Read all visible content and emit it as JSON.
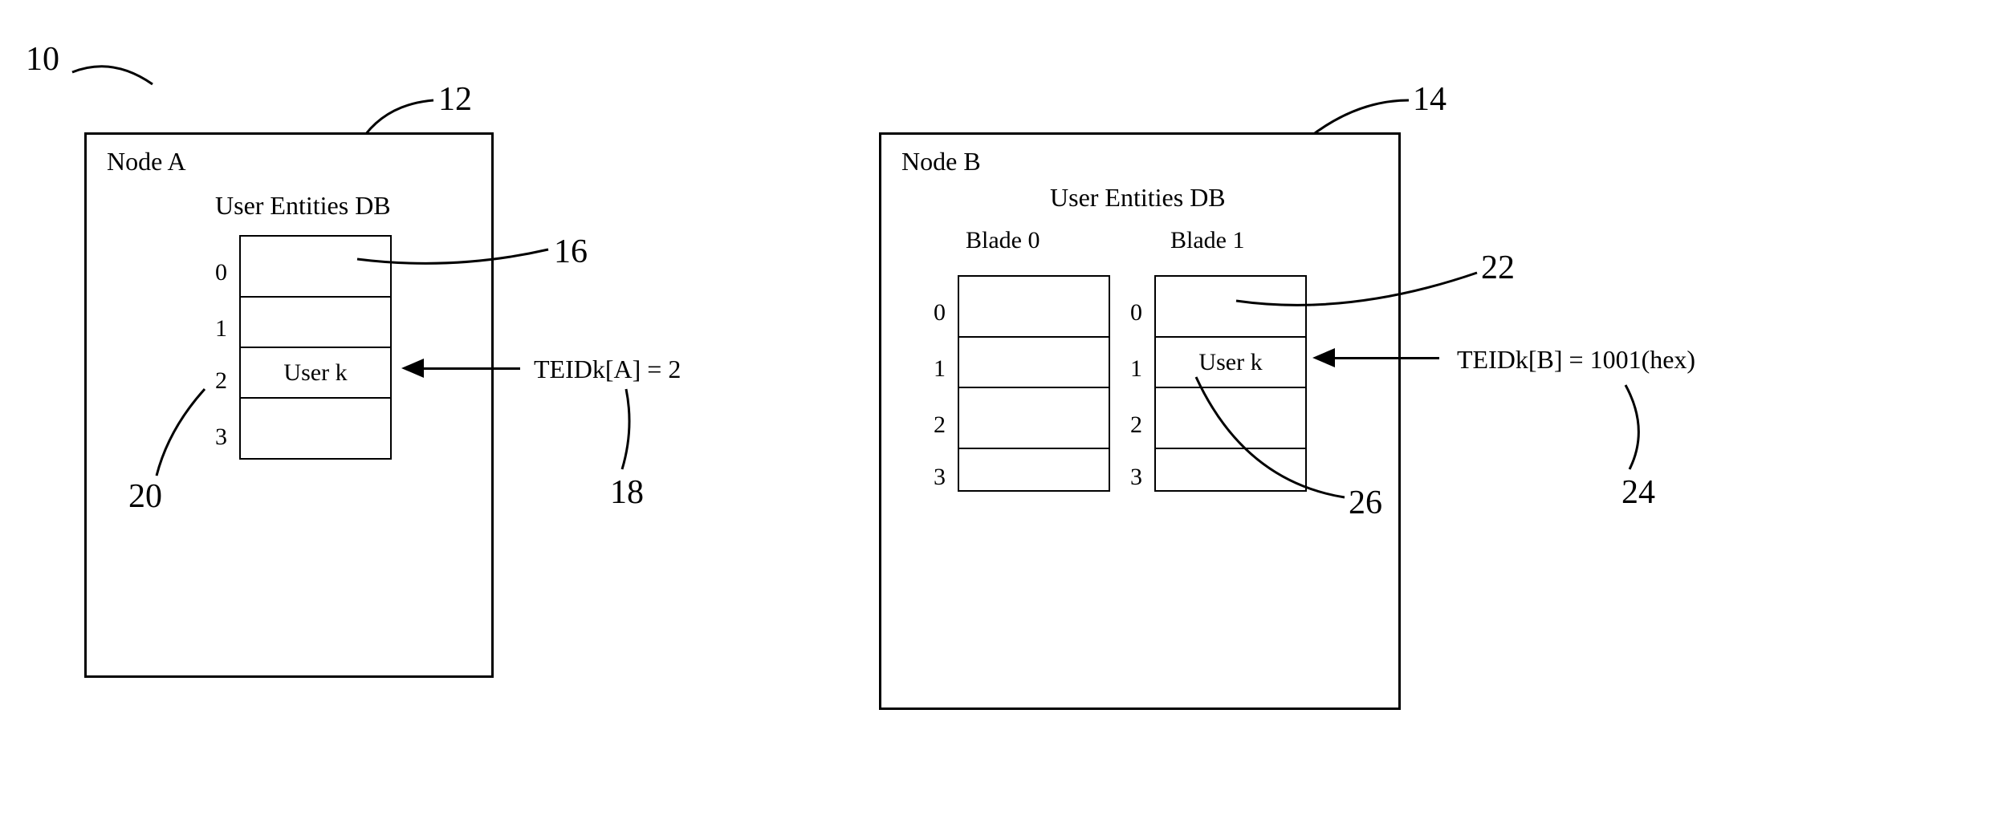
{
  "ref": {
    "r10": "10",
    "r12": "12",
    "r14": "14",
    "r16": "16",
    "r18": "18",
    "r20": "20",
    "r22": "22",
    "r24": "24",
    "r26": "26"
  },
  "nodeA": {
    "title": "Node A",
    "db_title": "User Entities DB",
    "rows": {
      "i0": "0",
      "i1": "1",
      "i2": "2",
      "i3": "3"
    },
    "user_cell": "User k",
    "teid": "TEIDk[A] = 2"
  },
  "nodeB": {
    "title": "Node B",
    "db_title": "User Entities DB",
    "blade0": "Blade 0",
    "blade1": "Blade 1",
    "rows": {
      "i0": "0",
      "i1": "1",
      "i2": "2",
      "i3": "3"
    },
    "user_cell": "User k",
    "teid": "TEIDk[B] = 1001(hex)"
  }
}
